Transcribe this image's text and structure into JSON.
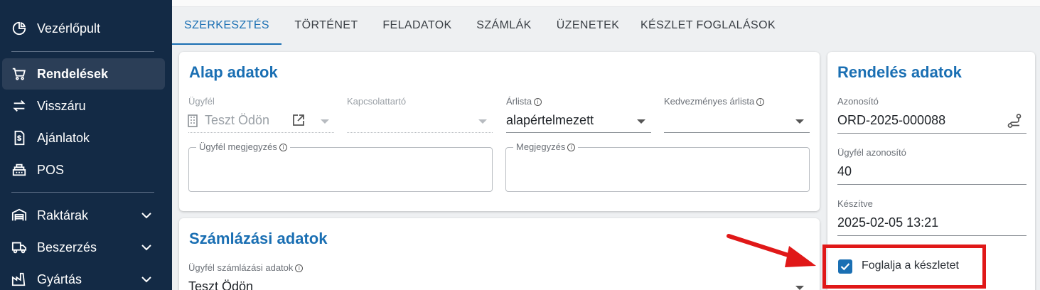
{
  "sidebar": {
    "items": [
      {
        "label": "Vezérlőpult",
        "icon": "dashboard-pie-icon"
      },
      {
        "label": "Rendelések",
        "icon": "cart-icon",
        "active": true
      },
      {
        "label": "Visszáru",
        "icon": "swap-arrows-icon"
      },
      {
        "label": "Ajánlatok",
        "icon": "document-dollar-icon"
      },
      {
        "label": "POS",
        "icon": "cash-register-icon"
      },
      {
        "label": "Raktárak",
        "icon": "warehouse-icon",
        "expandable": true
      },
      {
        "label": "Beszerzés",
        "icon": "truck-icon",
        "expandable": true
      },
      {
        "label": "Gyártás",
        "icon": "factory-icon",
        "expandable": true
      }
    ]
  },
  "tabs": [
    "SZERKESZTÉS",
    "TÖRTÉNET",
    "FELADATOK",
    "SZÁMLÁK",
    "ÜZENETEK",
    "KÉSZLET FOGLALÁSOK"
  ],
  "alap": {
    "title": "Alap adatok",
    "customer_label": "Ügyfél",
    "customer_value": "Teszt Ödön",
    "contact_label": "Kapcsolattartó",
    "pricelist_label": "Árlista",
    "pricelist_value": "alapértelmezett",
    "discount_pricelist_label": "Kedvezményes árlista",
    "customer_note_label": "Ügyfél megjegyzés",
    "note_label": "Megjegyzés"
  },
  "szamlazas": {
    "title": "Számlázási adatok",
    "billing_label": "Ügyfél számlázási adatok",
    "billing_value": "Teszt Ödön"
  },
  "rendeles": {
    "title": "Rendelés adatok",
    "id_label": "Azonosító",
    "id_value": "ORD-2025-000088",
    "customer_id_label": "Ügyfél azonosító",
    "customer_id_value": "40",
    "created_label": "Készítve",
    "created_value": "2025-02-05 13:21",
    "reserve_label": "Foglalja a készletet",
    "reserve_checked": true
  },
  "colors": {
    "sidebar_bg": "#132a45",
    "accent": "#1a6fb3",
    "annotation_red": "#e01818"
  }
}
